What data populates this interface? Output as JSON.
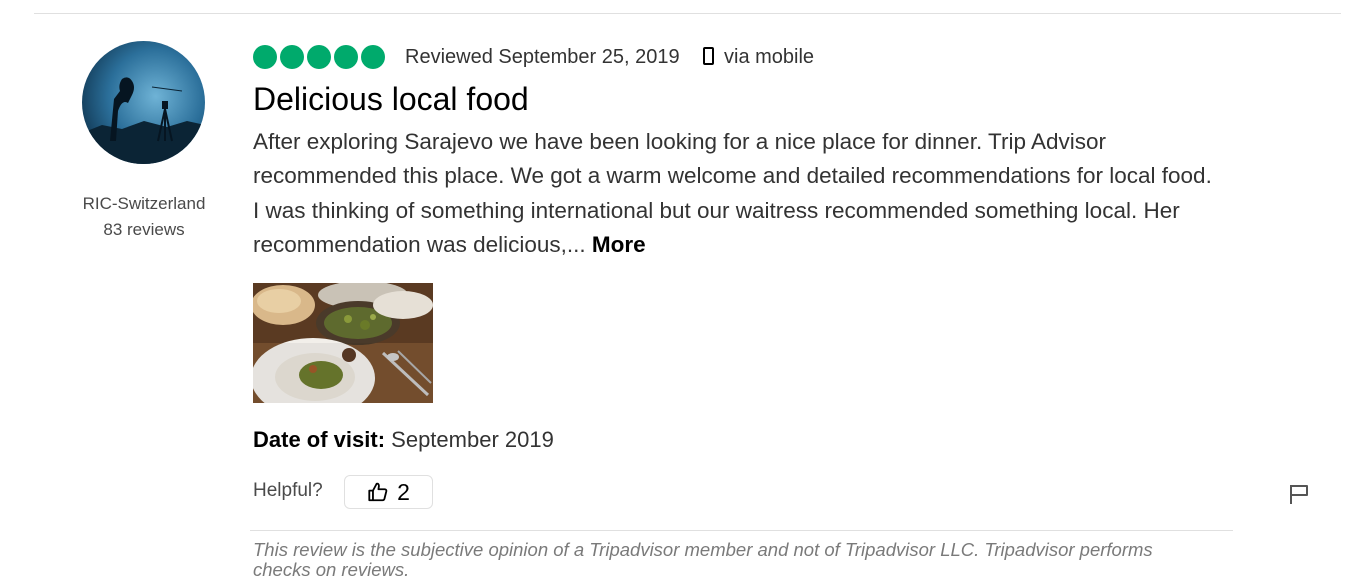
{
  "reviewer": {
    "name": "RIC-Switzerland",
    "reviews_count": "83 reviews",
    "avatar_icon": "user-avatar-icon"
  },
  "review": {
    "rating": 5,
    "rating_max": 5,
    "rating_color": "#00aa6c",
    "reviewed_date": "Reviewed September 25, 2019",
    "device_icon": "mobile-phone-icon",
    "device_text": "via mobile",
    "title": "Delicious local food",
    "body": "After exploring Sarajevo we have been looking for a nice place for dinner. Trip Advisor recommended this place. We got a warm welcome and detailed recommendations for local food. I was thinking of something international but our waitress recommended something local. Her recommendation was delicious,... ",
    "more_label": "More",
    "visit_label": "Date of visit:",
    "visit_value": "September 2019"
  },
  "helpful": {
    "label": "Helpful?",
    "count": "2",
    "icon": "thumbs-up-icon"
  },
  "flag_icon": "flag-icon",
  "disclaimer": "This review is the subjective opinion of a Tripadvisor member and not of Tripadvisor LLC. Tripadvisor performs checks on reviews."
}
